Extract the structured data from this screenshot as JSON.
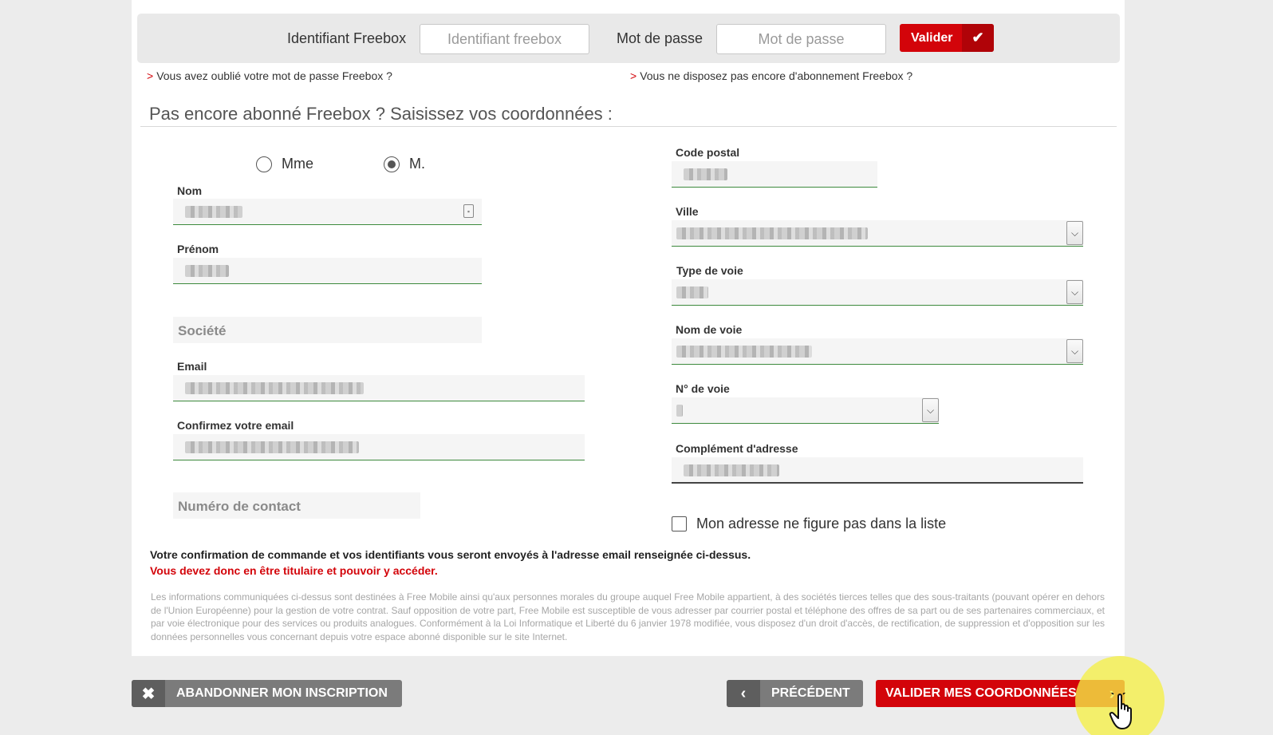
{
  "login": {
    "id_label": "Identifiant Freebox",
    "id_placeholder": "Identifiant freebox",
    "pwd_label": "Mot de passe",
    "pwd_placeholder": "Mot de passe",
    "submit_label": "Valider",
    "submit_icon": "checkmark-icon",
    "forgot_link": "Vous avez oublié votre mot de passe Freebox ?",
    "no_subscription_link": "Vous ne disposez pas encore d'abonnement Freebox ?"
  },
  "section_title": "Pas encore abonné Freebox ? Saisissez vos coordonnées :",
  "civility": {
    "options": [
      "Mme",
      "M."
    ],
    "selected": "M."
  },
  "left_fields": {
    "nom_label": "Nom",
    "prenom_label": "Prénom",
    "societe_placeholder": "Société",
    "email_label": "Email",
    "confirm_email_label": "Confirmez votre email",
    "contact_placeholder": "Numéro de contact"
  },
  "right_fields": {
    "code_postal_label": "Code postal",
    "ville_label": "Ville",
    "type_voie_label": "Type de voie",
    "nom_voie_label": "Nom de voie",
    "num_voie_label": "N° de voie",
    "complement_label": "Complément d'adresse",
    "not_in_list_label": "Mon adresse ne figure pas dans la liste"
  },
  "notice": {
    "line1": "Votre confirmation de commande et vos identifiants vous seront envoyés à l'adresse email renseignée ci-dessus.",
    "line2": "Vous devez donc en être titulaire et pouvoir y accéder.",
    "legal": "Les informations communiquées ci-dessus sont destinées à Free Mobile ainsi qu'aux personnes morales du groupe auquel Free Mobile appartient, à des sociétés tierces telles que des sous-traitants (pouvant opérer en dehors de l'Union Européenne) pour la gestion de votre contrat. Sauf opposition de votre part, Free Mobile est susceptible de vous adresser par courrier postal et téléphone des offres de sa part ou de ses partenaires commerciaux, et par voie électronique pour des services ou produits analogues. Conformément à la Loi Informatique et Liberté du 6 janvier 1978 modifiée, vous disposez d'un droit d'accès, de rectification, de suppression et d'opposition sur les données personnelles vous concernant depuis votre espace abonné disponible sur le site Internet."
  },
  "buttons": {
    "abandon": "ABANDONNER MON INSCRIPTION",
    "previous": "PRÉCÉDENT",
    "validate": "VALIDER MES COORDONNÉES"
  },
  "colors": {
    "brand_red": "#d3040a",
    "field_underline": "#3d8a3d",
    "gray_button": "#7b7b7b",
    "cursor_highlight": "#f5f046"
  }
}
